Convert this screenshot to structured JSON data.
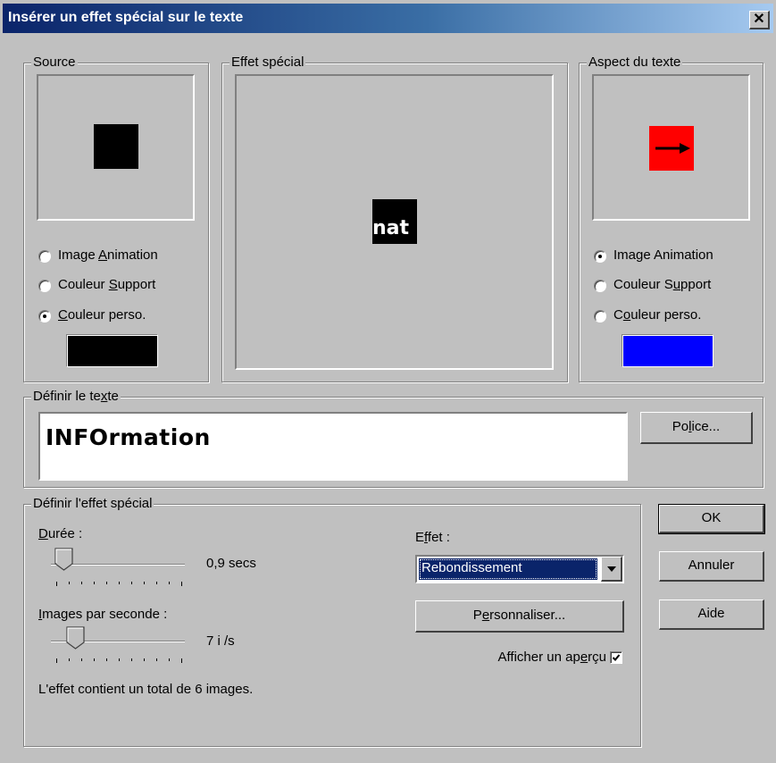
{
  "window": {
    "title": "Insérer un effet spécial sur le texte",
    "close_glyph": "✕"
  },
  "source": {
    "legend": "Source",
    "preview_color": "#000000",
    "options": [
      {
        "pre": "Image ",
        "acc": "A",
        "post": "nimation",
        "selected": false
      },
      {
        "pre": "Couleur ",
        "acc": "S",
        "post": "upport",
        "selected": false
      },
      {
        "pre": "",
        "acc": "C",
        "post": "ouleur perso.",
        "selected": true
      }
    ],
    "custom_color": "#000000"
  },
  "effect_preview": {
    "legend": "Effet spécial",
    "sample_text": "nat"
  },
  "aspect": {
    "legend": "Aspect du texte",
    "preview_color": "#ff0000",
    "arrow_icon": "right-arrow-icon",
    "options": [
      {
        "pre": "Ima",
        "acc": "g",
        "post": "e Animation",
        "selected": true
      },
      {
        "pre": "Couleur S",
        "acc": "u",
        "post": "pport",
        "selected": false
      },
      {
        "pre": "C",
        "acc": "o",
        "post": "uleur perso.",
        "selected": false
      }
    ],
    "custom_color": "#0000ff"
  },
  "text_group": {
    "legend_pre": "Définir le te",
    "legend_acc": "x",
    "legend_post": "te",
    "value": "INFOrmation",
    "font_button_pre": "Po",
    "font_button_acc": "l",
    "font_button_post": "ice..."
  },
  "effect_group": {
    "legend": "Définir l'effet spécial",
    "duration_label_acc": "D",
    "duration_label_post": "urée :",
    "duration_value": "0,9 secs",
    "fps_label_acc": "I",
    "fps_label_post": "mages par seconde :",
    "fps_value": "7 i /s",
    "total_text": "L'effet contient un total de 6 images.",
    "effect_label_pre": "E",
    "effect_label_acc": "f",
    "effect_label_post": "fet :",
    "effect_selected": "Rebondissement",
    "customize_pre": "P",
    "customize_acc": "e",
    "customize_post": "rsonnaliser...",
    "preview_pre": "Afficher un ap",
    "preview_acc": "e",
    "preview_post": "rçu",
    "preview_checked": true
  },
  "buttons": {
    "ok": "OK",
    "cancel": "Annuler",
    "help": "Aide"
  }
}
